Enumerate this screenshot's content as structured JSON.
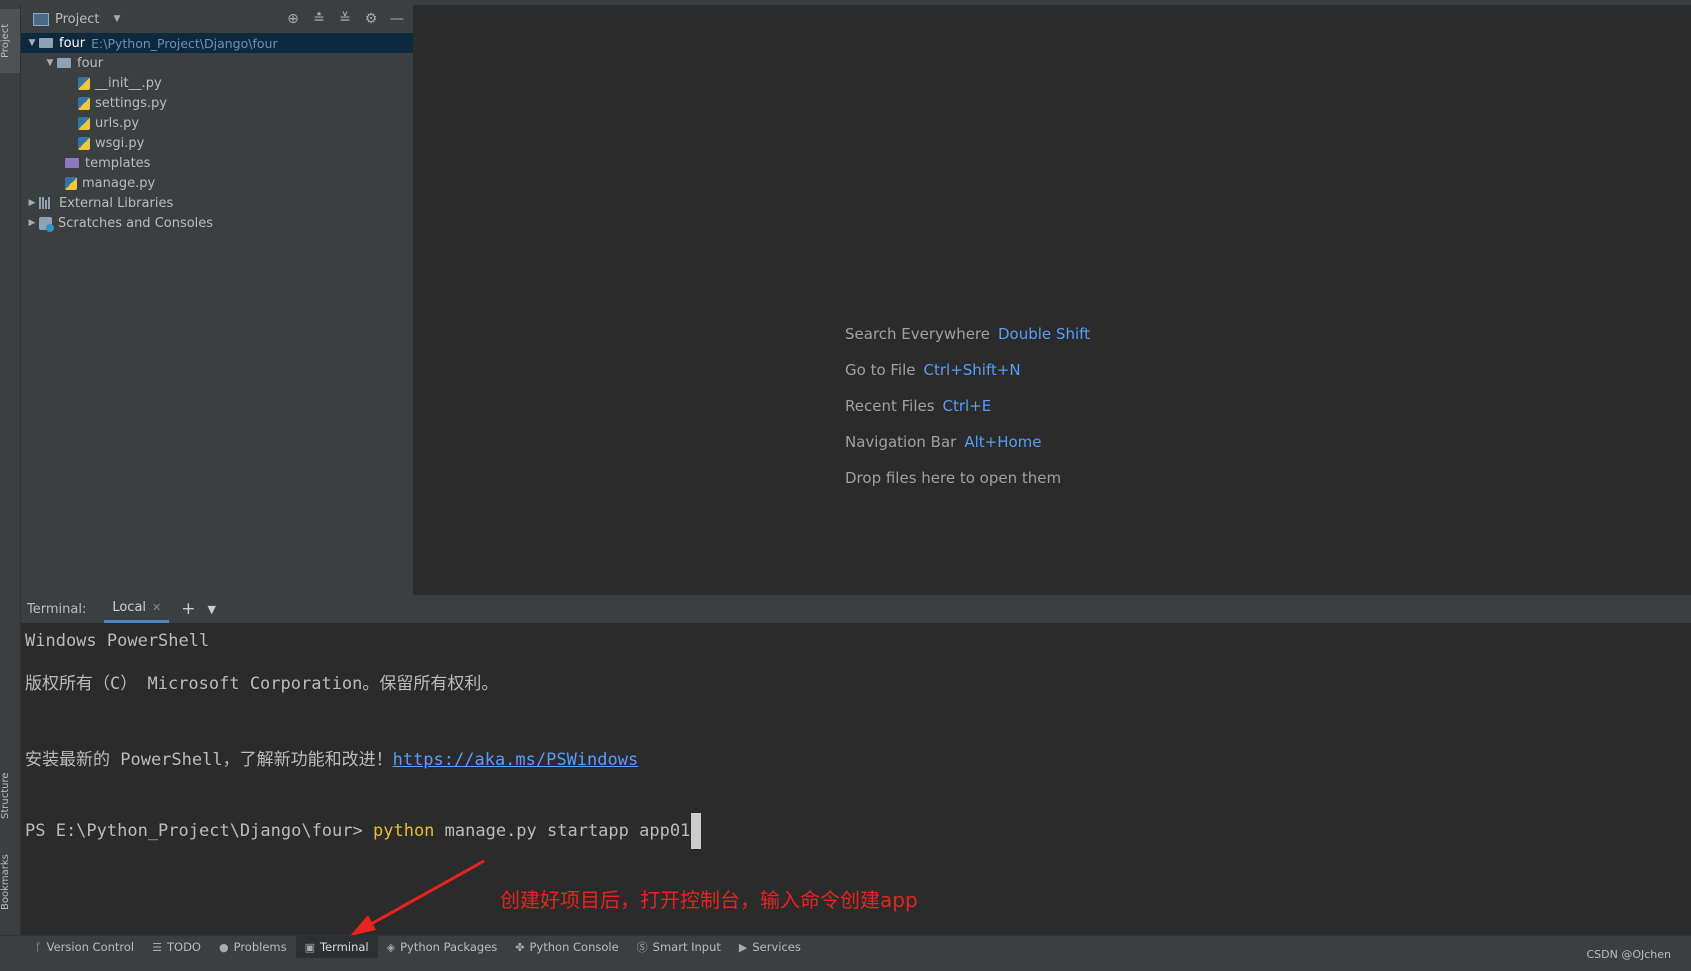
{
  "project_panel": {
    "title": "Project",
    "tree": {
      "root": {
        "name": "four",
        "path": "E:\\Python_Project\\Django\\four"
      },
      "pkg": "four",
      "files": [
        "__init__.py",
        "settings.py",
        "urls.py",
        "wsgi.py"
      ],
      "templates": "templates",
      "manage": "manage.py",
      "external": "External Libraries",
      "scratches": "Scratches and Consoles"
    }
  },
  "left_strip": {
    "project": "Project",
    "structure": "Structure",
    "bookmarks": "Bookmarks"
  },
  "editor_hints": [
    {
      "label": "Search Everywhere",
      "key": "Double Shift"
    },
    {
      "label": "Go to File",
      "key": "Ctrl+Shift+N"
    },
    {
      "label": "Recent Files",
      "key": "Ctrl+E"
    },
    {
      "label": "Navigation Bar",
      "key": "Alt+Home"
    },
    {
      "label": "Drop files here to open them",
      "key": ""
    }
  ],
  "terminal": {
    "label": "Terminal:",
    "tab": "Local",
    "lines": {
      "l1": "Windows PowerShell",
      "l2": "版权所有（C） Microsoft Corporation。保留所有权利。",
      "l3_text": "安装最新的 PowerShell，了解新功能和改进！",
      "l3_link": "https://aka.ms/PSWindows",
      "prompt": "PS E:\\Python_Project\\Django\\four> ",
      "cmd": "python",
      "args": " manage.py startapp app01"
    }
  },
  "annotation": "创建好项目后，打开控制台，输入命令创建app",
  "status_tabs": [
    {
      "icon": "branch-icon",
      "label": "Version Control"
    },
    {
      "icon": "list-icon",
      "label": "TODO"
    },
    {
      "icon": "problems-icon",
      "label": "Problems"
    },
    {
      "icon": "terminal-icon",
      "label": "Terminal"
    },
    {
      "icon": "packages-icon",
      "label": "Python Packages"
    },
    {
      "icon": "python-console-icon",
      "label": "Python Console"
    },
    {
      "icon": "smart-input-icon",
      "label": "Smart Input"
    },
    {
      "icon": "services-icon",
      "label": "Services"
    }
  ],
  "credit": "CSDN @OJchen"
}
